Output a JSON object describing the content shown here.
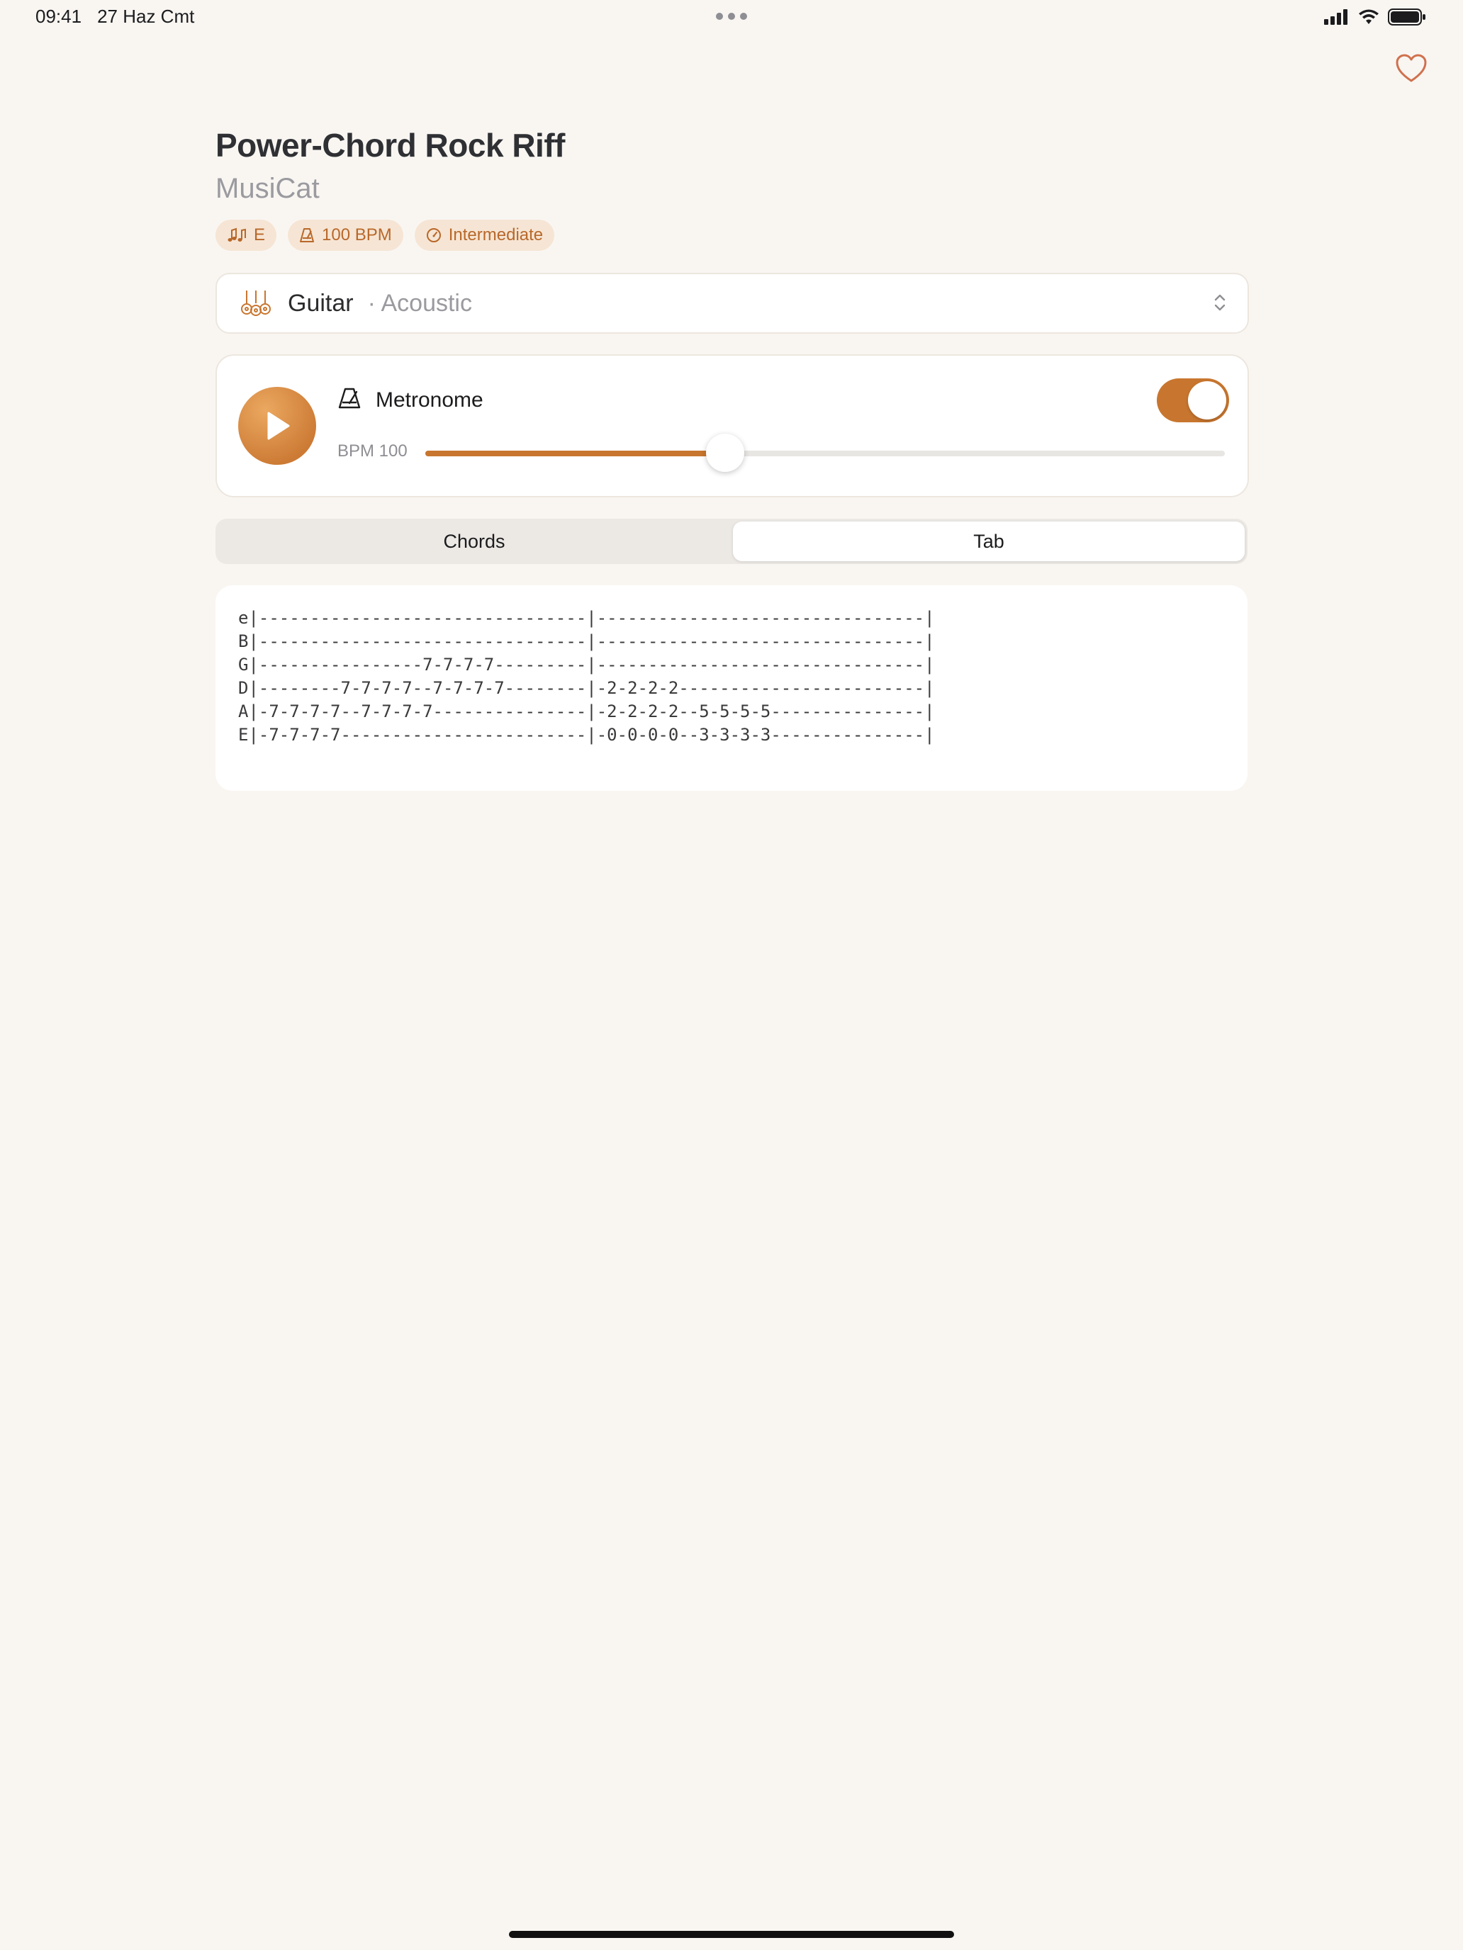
{
  "status_bar": {
    "time": "09:41",
    "date": "27 Haz Cmt"
  },
  "song": {
    "title": "Power-Chord Rock Riff",
    "artist": "MusiCat",
    "tags": {
      "key": "E",
      "tempo": "100 BPM",
      "level": "Intermediate"
    }
  },
  "instrument": {
    "name": "Guitar",
    "variant": "· Acoustic"
  },
  "metronome": {
    "label": "Metronome",
    "enabled": true,
    "bpm_label": "BPM 100",
    "bpm_value": 100,
    "bpm_min": 40,
    "bpm_max": 200
  },
  "tabs": {
    "chords": "Chords",
    "tab": "Tab",
    "selected": "Tab"
  },
  "tablature": [
    "e|--------------------------------|--------------------------------|",
    "B|--------------------------------|--------------------------------|",
    "G|----------------7-7-7-7---------|--------------------------------|",
    "D|--------7-7-7-7--7-7-7-7--------|-2-2-2-2------------------------|",
    "A|-7-7-7-7--7-7-7-7---------------|-2-2-2-2--5-5-5-5---------------|",
    "E|-7-7-7-7------------------------|-0-0-0-0--3-3-3-3---------------|"
  ],
  "colors": {
    "accent": "#c8762f",
    "tag_bg": "#f6e5d4",
    "background": "#f9f6f2"
  },
  "icons": [
    "ellipsis-icon",
    "cellular-signal-icon",
    "wifi-icon",
    "battery-icon",
    "heart-icon",
    "music-notes-icon",
    "metronome-icon",
    "gauge-icon",
    "guitars-icon",
    "chevron-up-down-icon",
    "play-icon"
  ]
}
